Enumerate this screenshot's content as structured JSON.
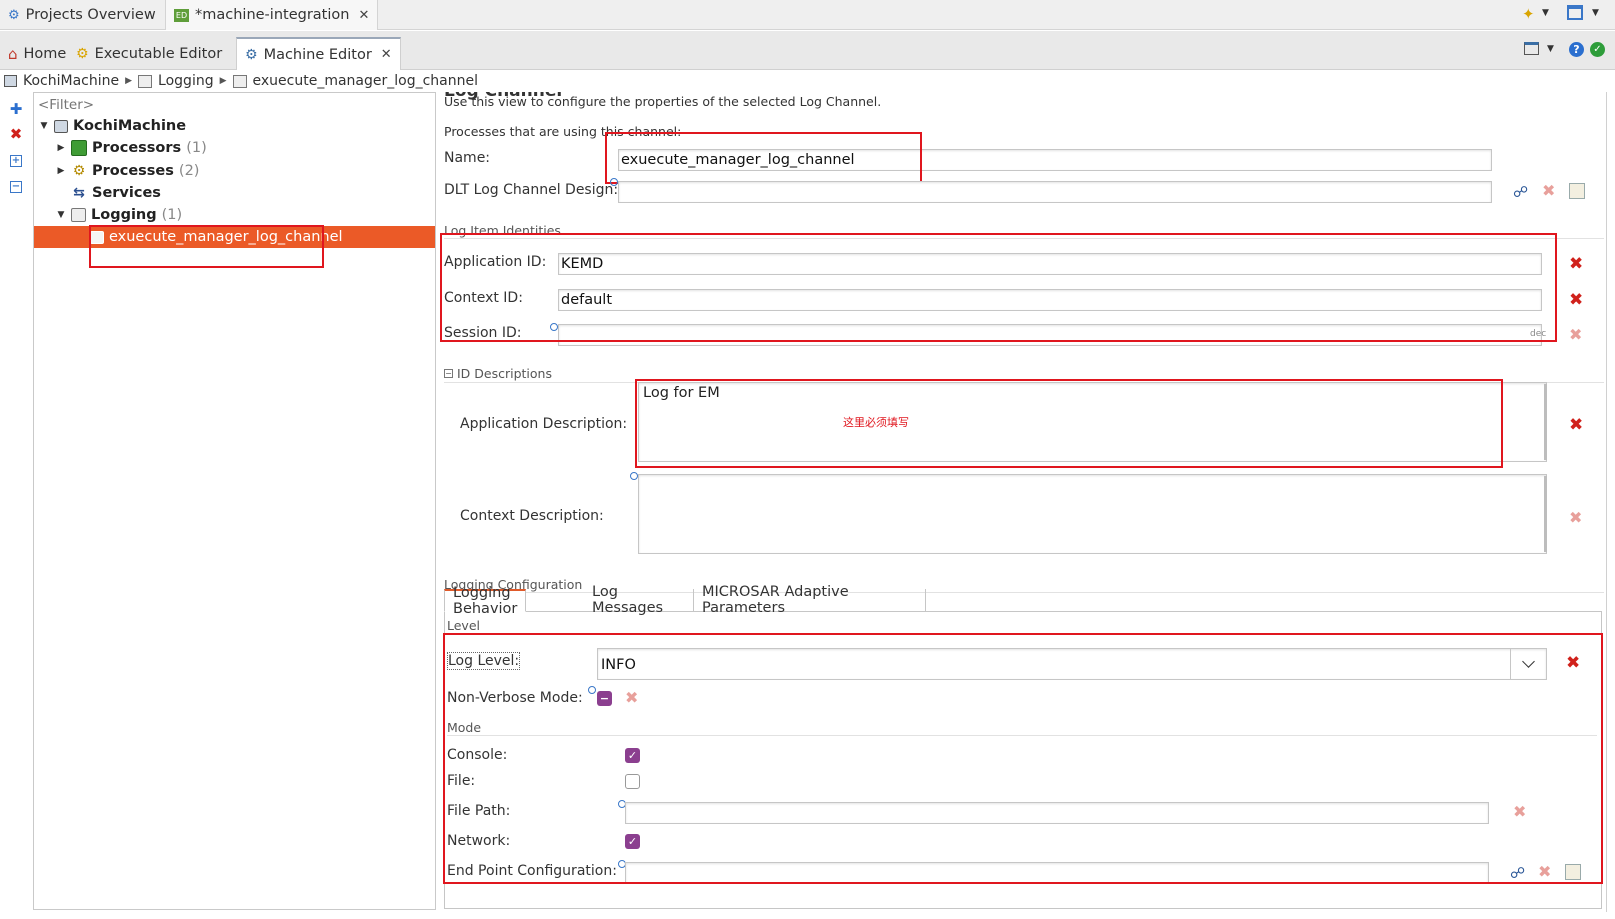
{
  "project_tabs": [
    {
      "label": "Projects Overview"
    },
    {
      "label": "*machine-integration"
    }
  ],
  "editor_tabs": [
    {
      "label": "Home"
    },
    {
      "label": "Executable Editor"
    },
    {
      "label": "Machine Editor"
    }
  ],
  "breadcrumb": [
    "KochiMachine",
    "Logging",
    "exuecute_manager_log_channel"
  ],
  "tree": {
    "filter_placeholder": "<Filter>",
    "root": "KochiMachine",
    "processors": {
      "label": "Processors",
      "count": "(1)"
    },
    "processes": {
      "label": "Processes",
      "count": "(2)"
    },
    "services": {
      "label": "Services"
    },
    "logging": {
      "label": "Logging",
      "count": "(1)"
    },
    "log_channel": "exuecute_manager_log_channel"
  },
  "form": {
    "header_partial": "Log Channel",
    "intro": "Use this view to configure the properties of the selected Log Channel.",
    "processes_using": "Processes that are using this channel: -",
    "name_label": "Name:",
    "name_value": "exuecute_manager_log_channel",
    "dlt_label": "DLT Log Channel Design:",
    "log_item_section": "Log Item Identities",
    "app_id_label": "Application ID:",
    "app_id_value": "KEMD",
    "context_id_label": "Context ID:",
    "context_id_value": "default",
    "session_id_label": "Session ID:",
    "session_suffix": "dec",
    "id_desc_section": "ID Descriptions",
    "app_desc_label": "Application Description:",
    "app_desc_value": "Log for EM",
    "annotation": "这里必须填写",
    "context_desc_label": "Context Description:",
    "logging_config_section": "Logging Configuration",
    "config_tabs": [
      "Logging Behavior",
      "Log Messages",
      "MICROSAR Adaptive Parameters"
    ],
    "level_section": "Level",
    "log_level_label": "Log Level:",
    "log_level_value": "INFO",
    "non_verbose_label": "Non-Verbose Mode:",
    "mode_section": "Mode",
    "console_label": "Console:",
    "file_label": "File:",
    "file_path_label": "File Path:",
    "network_label": "Network:",
    "endpoint_label": "End Point Configuration:"
  },
  "checkboxes": {
    "console": true,
    "file": false,
    "network": true
  },
  "colors": {
    "selection": "#eb5a27",
    "annotation_red": "#e0161e",
    "checkbox": "#8b3f8f"
  }
}
